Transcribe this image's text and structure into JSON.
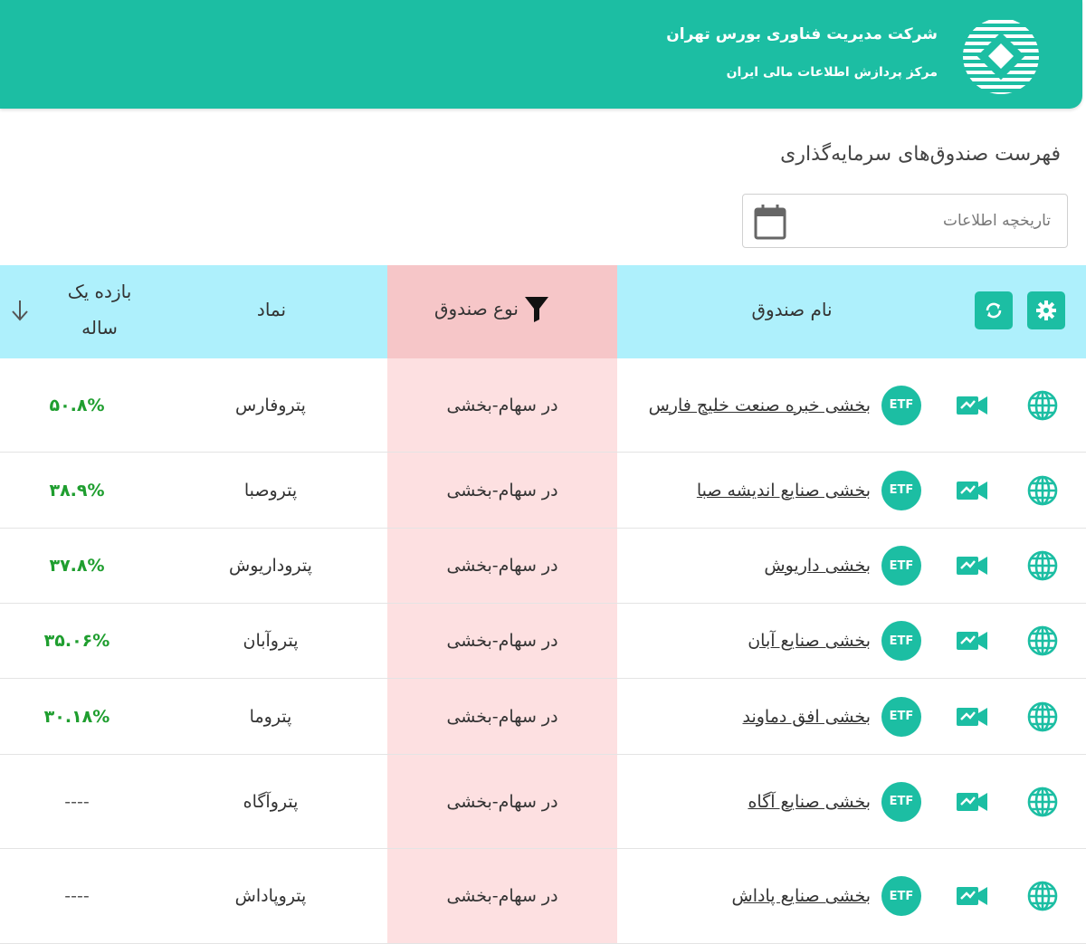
{
  "header": {
    "org_name": "شرکت مدیریت فناوری بورس تهران",
    "org_sub": "مرکز پردازش اطلاعات مالی ایران",
    "brand_color": "#1cbea3"
  },
  "page": {
    "title": "فهرست صندوق‌های سرمایه‌گذاری"
  },
  "date_filter": {
    "placeholder": "تاریخچه اطلاعات",
    "icon": "calendar-icon"
  },
  "table": {
    "headers": {
      "fund_name": "نام صندوق",
      "fund_type": "نوع صندوق",
      "symbol": "نماد",
      "return_line1": "بازده یک",
      "return_line2": "ساله"
    },
    "colors": {
      "header_bg": "#aef0fc",
      "type_header_bg": "#f6c6c8",
      "type_column_bg": "#fde0e1",
      "positive_return": "#1f9e2f"
    },
    "icons": [
      "globe-icon",
      "video-icon",
      "etf-badge",
      "settings-icon",
      "refresh-icon",
      "filter-icon",
      "sort-down-icon"
    ],
    "etf_label": "ETF",
    "rows": [
      {
        "name": "بخشی خبره صنعت خلیج فارس",
        "type": "در سهام-بخشی",
        "symbol": "پتروفارس",
        "return": "۵۰.۸%"
      },
      {
        "name": "بخشی صنایع اندیشه صبا",
        "type": "در سهام-بخشی",
        "symbol": "پتروصبا",
        "return": "۳۸.۹%"
      },
      {
        "name": "بخشی داریوش",
        "type": "در سهام-بخشی",
        "symbol": "پتروداریوش",
        "return": "۳۷.۸%"
      },
      {
        "name": "بخشی صنایع آبان",
        "type": "در سهام-بخشی",
        "symbol": "پتروآبان",
        "return": "۳۵.۰۶%"
      },
      {
        "name": "بخشی افق دماوند",
        "type": "در سهام-بخشی",
        "symbol": "پتروما",
        "return": "۳۰.۱۸%"
      },
      {
        "name": "بخشی صنایع آگاه",
        "type": "در سهام-بخشی",
        "symbol": "پتروآگاه",
        "return": "----"
      },
      {
        "name": "بخشی صنایع پاداش",
        "type": "در سهام-بخشی",
        "symbol": "پتروپاداش",
        "return": "----"
      }
    ]
  }
}
